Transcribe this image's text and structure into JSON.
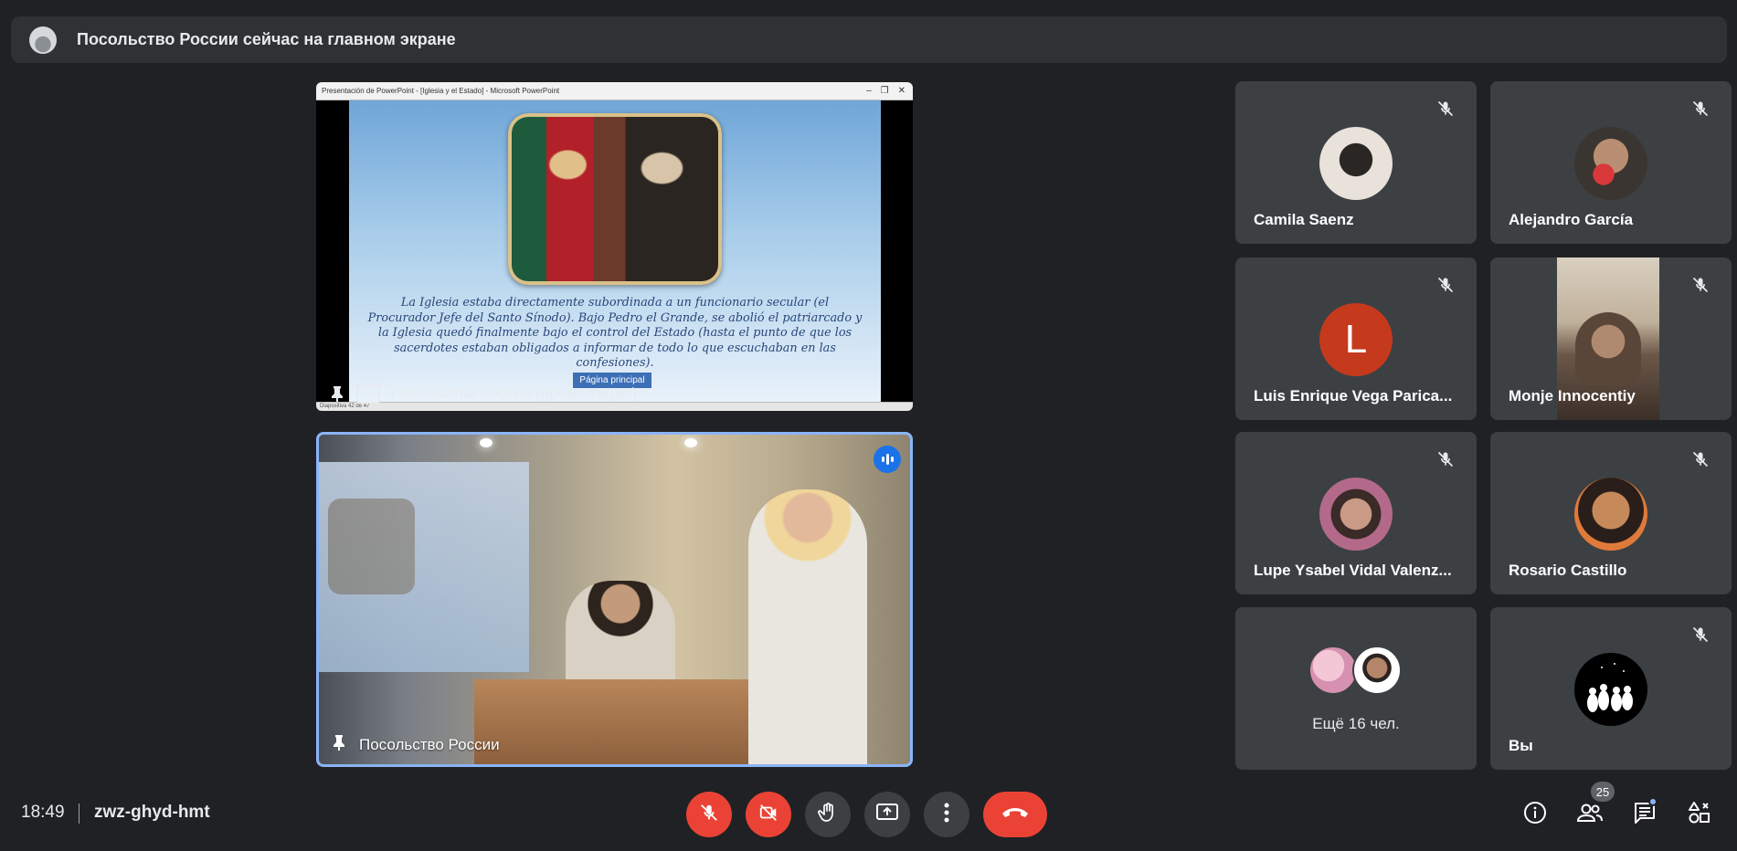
{
  "banner": {
    "text": "Посольство России сейчас на главном экране"
  },
  "presentation": {
    "window_title": "Presentación de PowerPoint - [Iglesia y el Estado] - Microsoft PowerPoint",
    "slide_text": "La Iglesia estaba directamente subordinada a un funcionario secular (el Procurador Jefe del Santo Sínodo). Bajo Pedro el Grande, se abolió el patriarcado y la Iglesia quedó finalmente bajo el control del Estado (hasta el punto de que los sacerdotes estaban obligados a informar de todo lo que escuchaban en las confesiones).",
    "slide_button": "Página principal",
    "statusbar": "Diapositiva 42 de 47",
    "label": "Посольство России (презентация)"
  },
  "speaker": {
    "label": "Посольство России"
  },
  "participants": [
    {
      "name": "Camila Saenz",
      "muted": true
    },
    {
      "name": "Alejandro García",
      "muted": true
    },
    {
      "name": "Luis Enrique Vega Parica...",
      "initial": "L",
      "muted": true
    },
    {
      "name": "Monje Innocentiy",
      "muted": true
    },
    {
      "name": "Lupe Ysabel Vidal Valenz...",
      "muted": true
    },
    {
      "name": "Rosario Castillo",
      "muted": true
    },
    {
      "more_text": "Ещё 16 чел."
    },
    {
      "name": "Вы",
      "muted": true
    }
  ],
  "bottom": {
    "time": "18:49",
    "meeting_code": "zwz-ghyd-hmt",
    "people_count": "25"
  },
  "colors": {
    "background": "#202124",
    "tile": "#3c4043",
    "danger": "#ea4335",
    "speaking": "#1a73e8",
    "active_border": "#8ab4f8"
  },
  "icons": [
    "mic-off-icon",
    "videocam-off-icon",
    "hand-icon",
    "present-icon",
    "more-vert-icon",
    "call-end-icon",
    "info-icon",
    "people-icon",
    "chat-icon",
    "activities-icon",
    "pin-icon"
  ]
}
